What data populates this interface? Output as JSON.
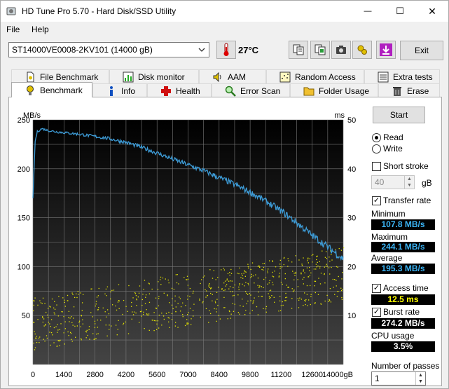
{
  "window": {
    "title": "HD Tune Pro 5.70 - Hard Disk/SSD Utility",
    "minimize_glyph": "—",
    "maximize_glyph": "☐",
    "close_glyph": "✕"
  },
  "menu": {
    "file": "File",
    "help": "Help"
  },
  "toolbar": {
    "drive": "ST14000VE0008-2KV101 (14000 gB)",
    "temperature": "27°C",
    "exit_label": "Exit",
    "icons": [
      "copy-text-icon",
      "copy-screenshot-icon",
      "camera-icon",
      "options-icon",
      "download-icon"
    ]
  },
  "tabs_top": [
    {
      "label": "File Benchmark",
      "icon": "file-benchmark-icon"
    },
    {
      "label": "Disk monitor",
      "icon": "disk-monitor-icon"
    },
    {
      "label": "AAM",
      "icon": "speaker-icon"
    },
    {
      "label": "Random Access",
      "icon": "random-access-icon"
    },
    {
      "label": "Extra tests",
      "icon": "extra-tests-icon"
    }
  ],
  "tabs_bottom": [
    {
      "label": "Benchmark",
      "icon": "benchmark-icon",
      "active": true
    },
    {
      "label": "Info",
      "icon": "info-icon"
    },
    {
      "label": "Health",
      "icon": "health-cross-icon"
    },
    {
      "label": "Error Scan",
      "icon": "magnifier-icon"
    },
    {
      "label": "Folder Usage",
      "icon": "folder-icon"
    },
    {
      "label": "Erase",
      "icon": "trash-icon"
    }
  ],
  "controls": {
    "start_label": "Start",
    "read_label": "Read",
    "write_label": "Write",
    "mode": "read",
    "short_stroke_label": "Short stroke",
    "short_stroke_checked": false,
    "short_stroke_value": "40",
    "short_stroke_unit": "gB",
    "transfer_rate_label": "Transfer rate",
    "transfer_rate_checked": true,
    "access_time_label": "Access time",
    "access_time_checked": true,
    "burst_rate_label": "Burst rate",
    "burst_rate_checked": true,
    "passes_label": "Number of passes",
    "passes_value": "1"
  },
  "stats": {
    "minimum_label": "Minimum",
    "minimum_value": "107.8 MB/s",
    "maximum_label": "Maximum",
    "maximum_value": "244.1 MB/s",
    "average_label": "Average",
    "average_value": "195.3 MB/s",
    "access_time_value": "12.5 ms",
    "burst_rate_value": "274.2 MB/s",
    "cpu_label": "CPU usage",
    "cpu_value": "3.5%"
  },
  "colors": {
    "transfer_line": "#3d9bd6",
    "access_dots": "#e6e600",
    "stat_blue": "#3bb4f5",
    "stat_yellow": "#ffff00",
    "stat_white": "#ffffff"
  },
  "chart_data": {
    "type": "line",
    "ylabel": "MB/s",
    "y2label": "ms",
    "xunit": "gB",
    "x_ticks": [
      0,
      1400,
      2800,
      4200,
      5600,
      7000,
      8400,
      9800,
      11200,
      12600,
      14000
    ],
    "y_ticks": [
      0,
      50,
      100,
      150,
      200,
      250
    ],
    "y2_ticks": [
      10,
      20,
      30,
      40,
      50
    ],
    "xlim": [
      0,
      14000
    ],
    "ylim": [
      0,
      250
    ],
    "y2lim": [
      0,
      50
    ],
    "grid": true,
    "series": [
      {
        "axis": "left",
        "x": [
          0,
          100,
          200,
          400,
          700,
          1000,
          1400,
          1800,
          2200,
          2800,
          3400,
          4200,
          4900,
          5600,
          6300,
          7000,
          7700,
          8400,
          9100,
          9800,
          10500,
          11200,
          11900,
          12600,
          13300,
          14000
        ],
        "values": [
          170,
          228,
          238,
          241,
          239,
          238,
          237,
          236,
          235,
          233,
          231,
          227,
          222,
          216,
          210,
          204,
          198,
          191,
          184,
          176,
          167,
          157,
          145,
          132,
          120,
          108
        ]
      }
    ],
    "access_time_ms_range": [
      3,
      30
    ]
  }
}
